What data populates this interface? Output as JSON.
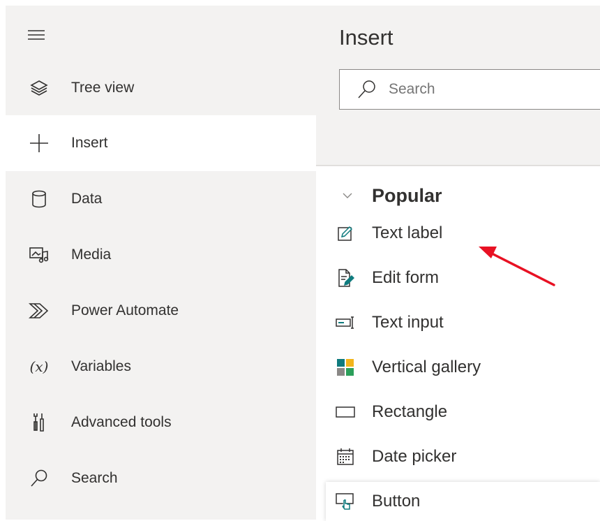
{
  "nav": {
    "items": [
      {
        "label": "Tree view",
        "icon": "layers-icon"
      },
      {
        "label": "Insert",
        "icon": "plus-icon",
        "selected": true
      },
      {
        "label": "Data",
        "icon": "database-icon"
      },
      {
        "label": "Media",
        "icon": "media-icon"
      },
      {
        "label": "Power Automate",
        "icon": "power-automate-icon"
      },
      {
        "label": "Variables",
        "icon": "variables-icon",
        "glyph": "(x)"
      },
      {
        "label": "Advanced tools",
        "icon": "tools-icon"
      },
      {
        "label": "Search",
        "icon": "search-icon"
      }
    ]
  },
  "panel": {
    "title": "Insert",
    "search_placeholder": "Search",
    "section": "Popular",
    "controls": [
      {
        "label": "Text label",
        "icon": "text-label-icon"
      },
      {
        "label": "Edit form",
        "icon": "edit-form-icon"
      },
      {
        "label": "Text input",
        "icon": "text-input-icon"
      },
      {
        "label": "Vertical gallery",
        "icon": "gallery-icon"
      },
      {
        "label": "Rectangle",
        "icon": "rectangle-icon"
      },
      {
        "label": "Date picker",
        "icon": "calendar-icon"
      },
      {
        "label": "Button",
        "icon": "button-icon"
      }
    ]
  },
  "colors": {
    "rail_bg": "#f3f2f1",
    "accent_teal": "#0f7b7e",
    "annotation_red": "#e81123"
  }
}
